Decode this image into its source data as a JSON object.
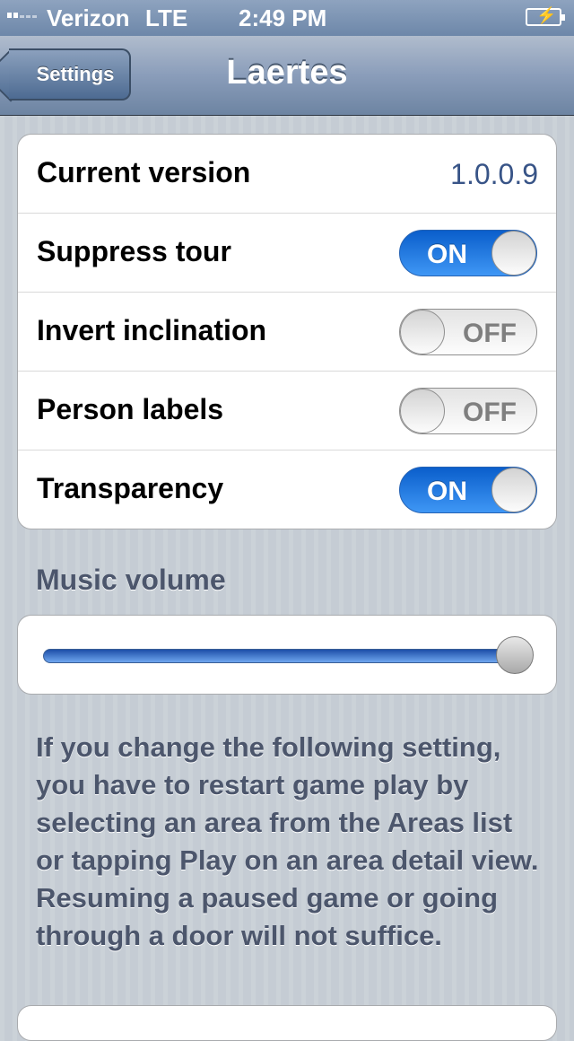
{
  "status_bar": {
    "carrier": "Verizon",
    "network": "LTE",
    "time": "2:49 PM"
  },
  "nav": {
    "back_label": "Settings",
    "title": "Laertes"
  },
  "settings": [
    {
      "label": "Current version",
      "value": "1.0.0.9"
    },
    {
      "label": "Suppress tour",
      "toggle": "ON"
    },
    {
      "label": "Invert inclination",
      "toggle": "OFF"
    },
    {
      "label": "Person labels",
      "toggle": "OFF"
    },
    {
      "label": "Transparency",
      "toggle": "ON"
    }
  ],
  "music": {
    "header": "Music volume",
    "volume": 1.0
  },
  "footer": "If you change the following setting, you have to restart game play by selecting an area from the Areas list or tapping Play on an area detail view. Resuming a paused game or going through a door will not suffice.",
  "colors": {
    "switch_on": "#2a7ee8",
    "value_text": "#385487",
    "nav_bar": "#6d84a2"
  }
}
